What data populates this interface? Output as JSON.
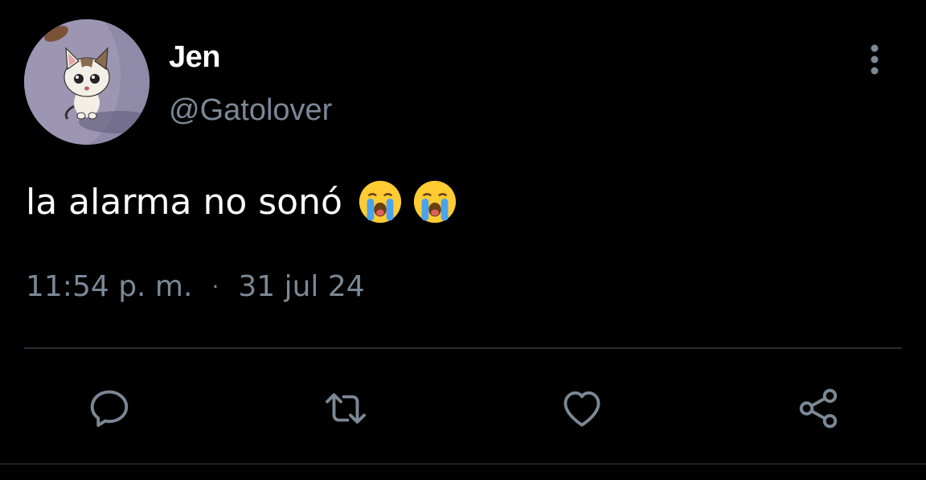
{
  "user": {
    "display_name": "Jen",
    "handle": "@Gatolover",
    "avatar": "cat-avatar"
  },
  "tweet": {
    "text": "la alarma no sonó",
    "emojis": [
      "loudly-crying-face",
      "loudly-crying-face"
    ]
  },
  "meta": {
    "time": "11:54 p. m.",
    "separator": "·",
    "date": "31 jul 24"
  },
  "actions": [
    {
      "name": "reply",
      "icon": "reply-icon"
    },
    {
      "name": "retweet",
      "icon": "retweet-icon"
    },
    {
      "name": "like",
      "icon": "heart-icon"
    },
    {
      "name": "share",
      "icon": "share-icon"
    }
  ],
  "colors": {
    "background": "#000000",
    "primary_text": "#ffffff",
    "secondary_text": "#7b8896",
    "divider": "#2a2e33"
  }
}
